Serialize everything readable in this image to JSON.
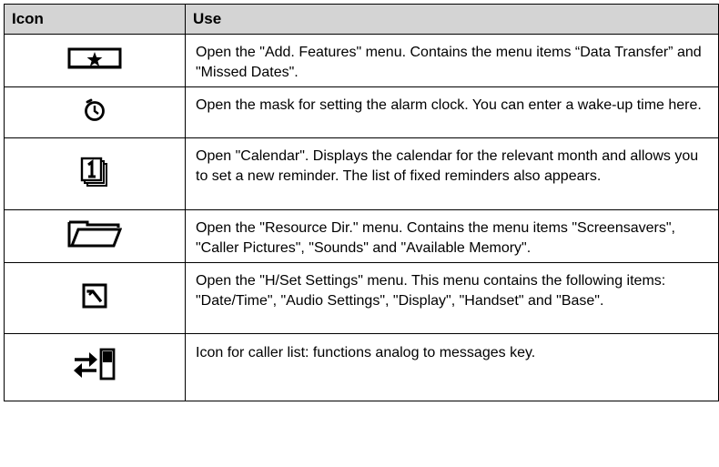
{
  "table": {
    "headers": {
      "icon": "Icon",
      "use": "Use"
    },
    "rows": [
      {
        "icon": "star-box-icon",
        "use": "Open the \"Add. Features\" menu. Contains the menu items “Data Transfer” and \"Missed Dates\"."
      },
      {
        "icon": "alarm-clock-icon",
        "use": "Open the mask for setting the alarm clock. You can enter a wake-up time here."
      },
      {
        "icon": "calendar-icon",
        "use": "Open \"Calendar\". Displays the calendar for the relevant month and allows you to set a new reminder. The list of fixed reminders also appears."
      },
      {
        "icon": "folder-icon",
        "use": "Open the \"Resource Dir.\" menu. Contains the menu items \"Screensavers\", \"Caller Pictures\", \"Sounds\" and \"Available Memory\"."
      },
      {
        "icon": "settings-tool-icon",
        "use": "Open the \"H/Set Settings\" menu. This menu contains the following items: \"Date/Time\", \"Audio Settings\", \"Display\", \"Handset\" and \"Base\"."
      },
      {
        "icon": "caller-list-icon",
        "use": "Icon for caller list: functions analog to messages key."
      }
    ]
  }
}
